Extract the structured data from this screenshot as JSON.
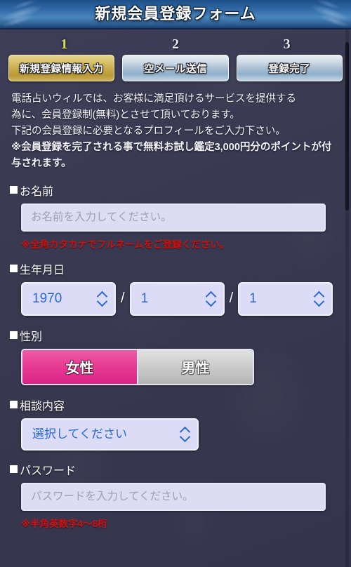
{
  "header": {
    "title": "新規会員登録フォーム"
  },
  "steps": {
    "items": [
      {
        "number": "1",
        "label": "新規登録情報入力",
        "active": true
      },
      {
        "number": "2",
        "label": "空メール送信",
        "active": false
      },
      {
        "number": "3",
        "label": "登録完了",
        "active": false
      }
    ]
  },
  "intro": {
    "line1": "電話占いウィルでは、お客様に満足頂けるサービスを提供する",
    "line2": "為に、会員登録制(無料)とさせて頂いております。",
    "line3": "下記の会員登録に必要となるプロフィールをご入力下さい。",
    "notice": "※会員登録を完了される事で無料お試し鑑定3,000円分のポイントが付与されます。"
  },
  "form": {
    "name": {
      "label": "お名前",
      "placeholder": "お名前を入力してください。",
      "value": "",
      "hint": "※全角カタカナでフルネームをご登録ください。"
    },
    "birthdate": {
      "label": "生年月日",
      "year": "1970",
      "month": "1",
      "day": "1",
      "separator": "/"
    },
    "gender": {
      "label": "性別",
      "female_label": "女性",
      "male_label": "男性",
      "selected": "女性"
    },
    "topic": {
      "label": "相談内容",
      "selected": "選択してください"
    },
    "password": {
      "label": "パスワード",
      "placeholder": "パスワードを入力してください。",
      "value": "",
      "hint": "※半角英数字4〜8桁"
    }
  },
  "colors": {
    "header_blue": "#2e67a4",
    "step_active_gold": "#d9c169",
    "step_number_active": "#d8d86a",
    "notice_red": "#c81414",
    "female_pink": "#e83d95",
    "male_gray": "#cfcfcf",
    "input_lavender": "#dcdcf2",
    "select_blue_text": "#2a6ad8",
    "background_navy": "#3b3b55"
  }
}
